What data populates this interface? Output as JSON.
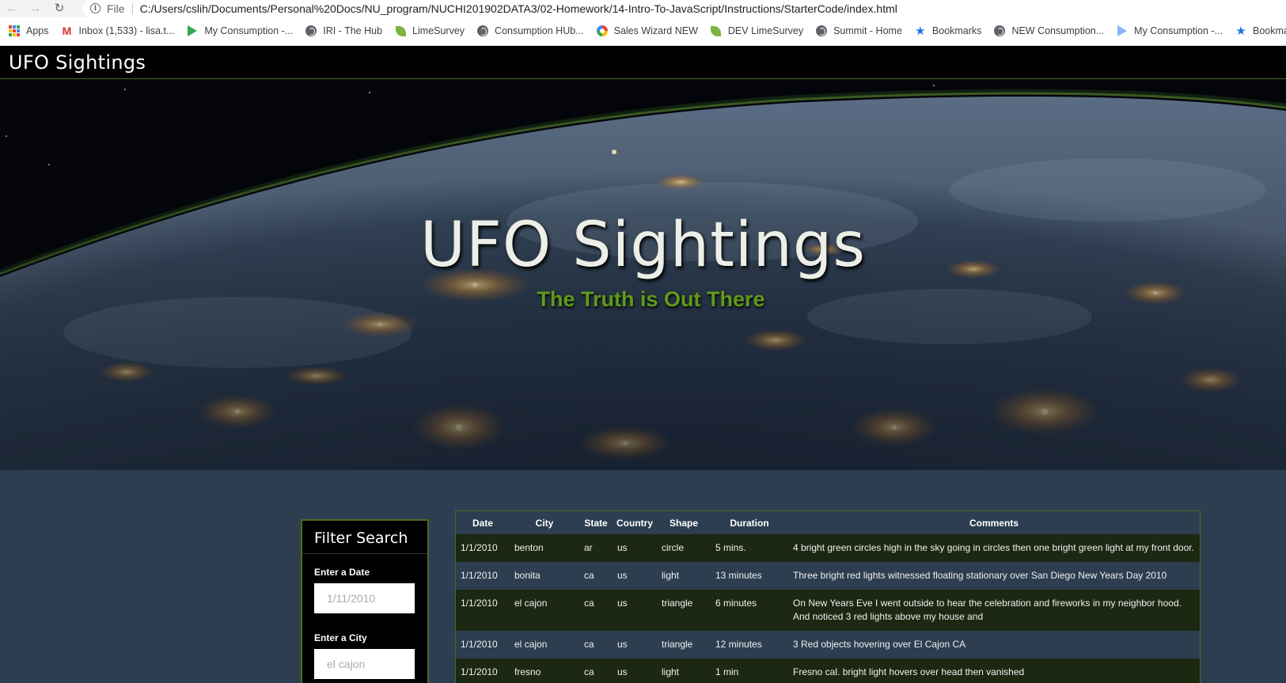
{
  "browser": {
    "scheme": "File",
    "url": "C:/Users/cslih/Documents/Personal%20Docs/NU_program/NUCHI201902DATA3/02-Homework/14-Intro-To-JavaScript/Instructions/StarterCode/index.html",
    "bookmarks": [
      {
        "label": "Apps",
        "icon": "apps-grid-icon"
      },
      {
        "label": "Inbox (1,533) - lisa.t...",
        "icon": "gmail-icon"
      },
      {
        "label": "My Consumption -...",
        "icon": "play-icon"
      },
      {
        "label": "IRI - The Hub",
        "icon": "globe-icon"
      },
      {
        "label": "LimeSurvey",
        "icon": "limesurvey-icon"
      },
      {
        "label": "Consumption HUb...",
        "icon": "globe-icon"
      },
      {
        "label": "Sales Wizard NEW",
        "icon": "sales-wizard-icon"
      },
      {
        "label": "DEV LimeSurvey",
        "icon": "limesurvey-icon"
      },
      {
        "label": "Summit - Home",
        "icon": "globe-icon"
      },
      {
        "label": "Bookmarks",
        "icon": "star-icon"
      },
      {
        "label": "NEW Consumption...",
        "icon": "globe-icon"
      },
      {
        "label": "My Consumption -...",
        "icon": "play-icon"
      },
      {
        "label": "Bookmark",
        "icon": "star-icon"
      }
    ]
  },
  "nav": {
    "brand": "UFO Sightings"
  },
  "hero": {
    "title": "UFO Sightings",
    "subtitle": "The Truth is Out There"
  },
  "filter": {
    "title": "Filter Search",
    "date_label": "Enter a Date",
    "date_placeholder": "1/11/2010",
    "city_label": "Enter a City",
    "city_placeholder": "el cajon"
  },
  "table": {
    "columns": [
      "Date",
      "City",
      "State",
      "Country",
      "Shape",
      "Duration",
      "Comments"
    ],
    "rows": [
      [
        "1/1/2010",
        "benton",
        "ar",
        "us",
        "circle",
        "5 mins.",
        "4 bright green circles high in the sky going in circles then one bright green light at my front door."
      ],
      [
        "1/1/2010",
        "bonita",
        "ca",
        "us",
        "light",
        "13 minutes",
        "Three bright red lights witnessed floating stationary over San Diego New Years Day 2010"
      ],
      [
        "1/1/2010",
        "el cajon",
        "ca",
        "us",
        "triangle",
        "6 minutes",
        "On New Years Eve I went outside to hear the celebration and fireworks in my neighbor hood. And noticed 3 red lights above my house and"
      ],
      [
        "1/1/2010",
        "el cajon",
        "ca",
        "us",
        "triangle",
        "12 minutes",
        "3 Red objects hovering over El Cajon CA"
      ],
      [
        "1/1/2010",
        "fresno",
        "ca",
        "us",
        "light",
        "1 min",
        "Fresno cal. bright light hovers over head then vanished"
      ]
    ]
  },
  "colors": {
    "page_bg": "#2d3e50",
    "accent_green": "#4b6b1f",
    "subtitle_green": "#5f9a1a",
    "row_dark": "#1c2812",
    "row_blue": "#2c3e50"
  }
}
